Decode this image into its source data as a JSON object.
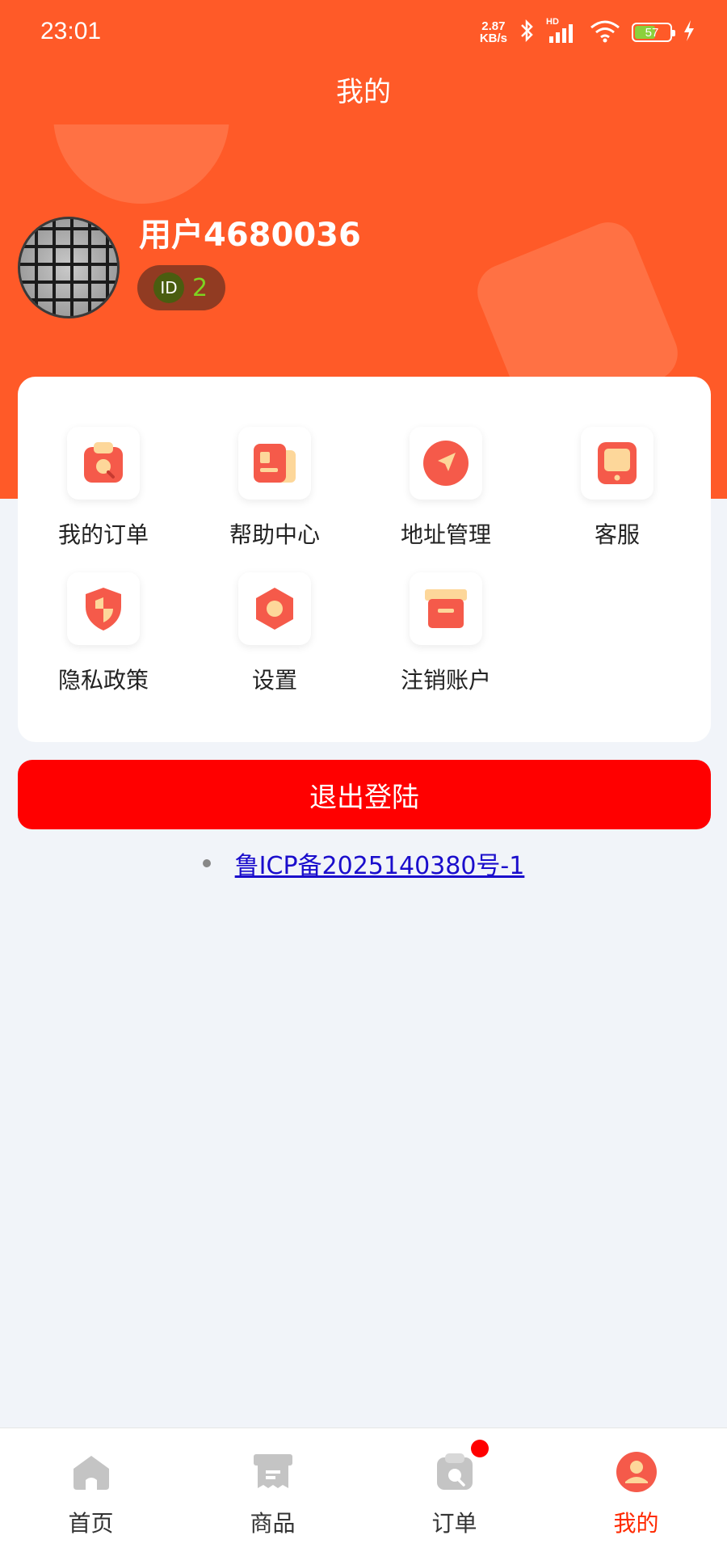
{
  "status_bar": {
    "time": "23:01",
    "net_speed_value": "2.87",
    "net_speed_unit": "KB/s",
    "signal_tag": "HD",
    "battery": "57"
  },
  "header": {
    "title": "我的"
  },
  "user": {
    "name": "用户4680036",
    "id_badge": "ID",
    "id_value": "2"
  },
  "menu": {
    "items": [
      {
        "label": "我的订单",
        "icon": "order-search-icon"
      },
      {
        "label": "帮助中心",
        "icon": "help-doc-icon"
      },
      {
        "label": "地址管理",
        "icon": "location-arrow-icon"
      },
      {
        "label": "客服",
        "icon": "customer-service-icon"
      },
      {
        "label": "隐私政策",
        "icon": "privacy-shield-icon"
      },
      {
        "label": "设置",
        "icon": "settings-hexagon-icon"
      },
      {
        "label": "注销账户",
        "icon": "archive-box-icon"
      }
    ]
  },
  "logout_label": "退出登陆",
  "icp": {
    "text": "鲁ICP备2025140380号-1"
  },
  "tabbar": {
    "items": [
      {
        "label": "首页",
        "icon": "home-icon",
        "active": false
      },
      {
        "label": "商品",
        "icon": "shop-icon",
        "active": false
      },
      {
        "label": "订单",
        "icon": "order-icon",
        "active": false
      },
      {
        "label": "我的",
        "icon": "profile-icon",
        "active": true
      }
    ]
  },
  "colors": {
    "accent": "#ff5a28",
    "icon_primary": "#f55a4a",
    "icon_secondary": "#fdd79a",
    "logout": "#ff0000",
    "tab_active": "#ff2a00",
    "tab_inactive_icon": "#c4c4c4"
  }
}
